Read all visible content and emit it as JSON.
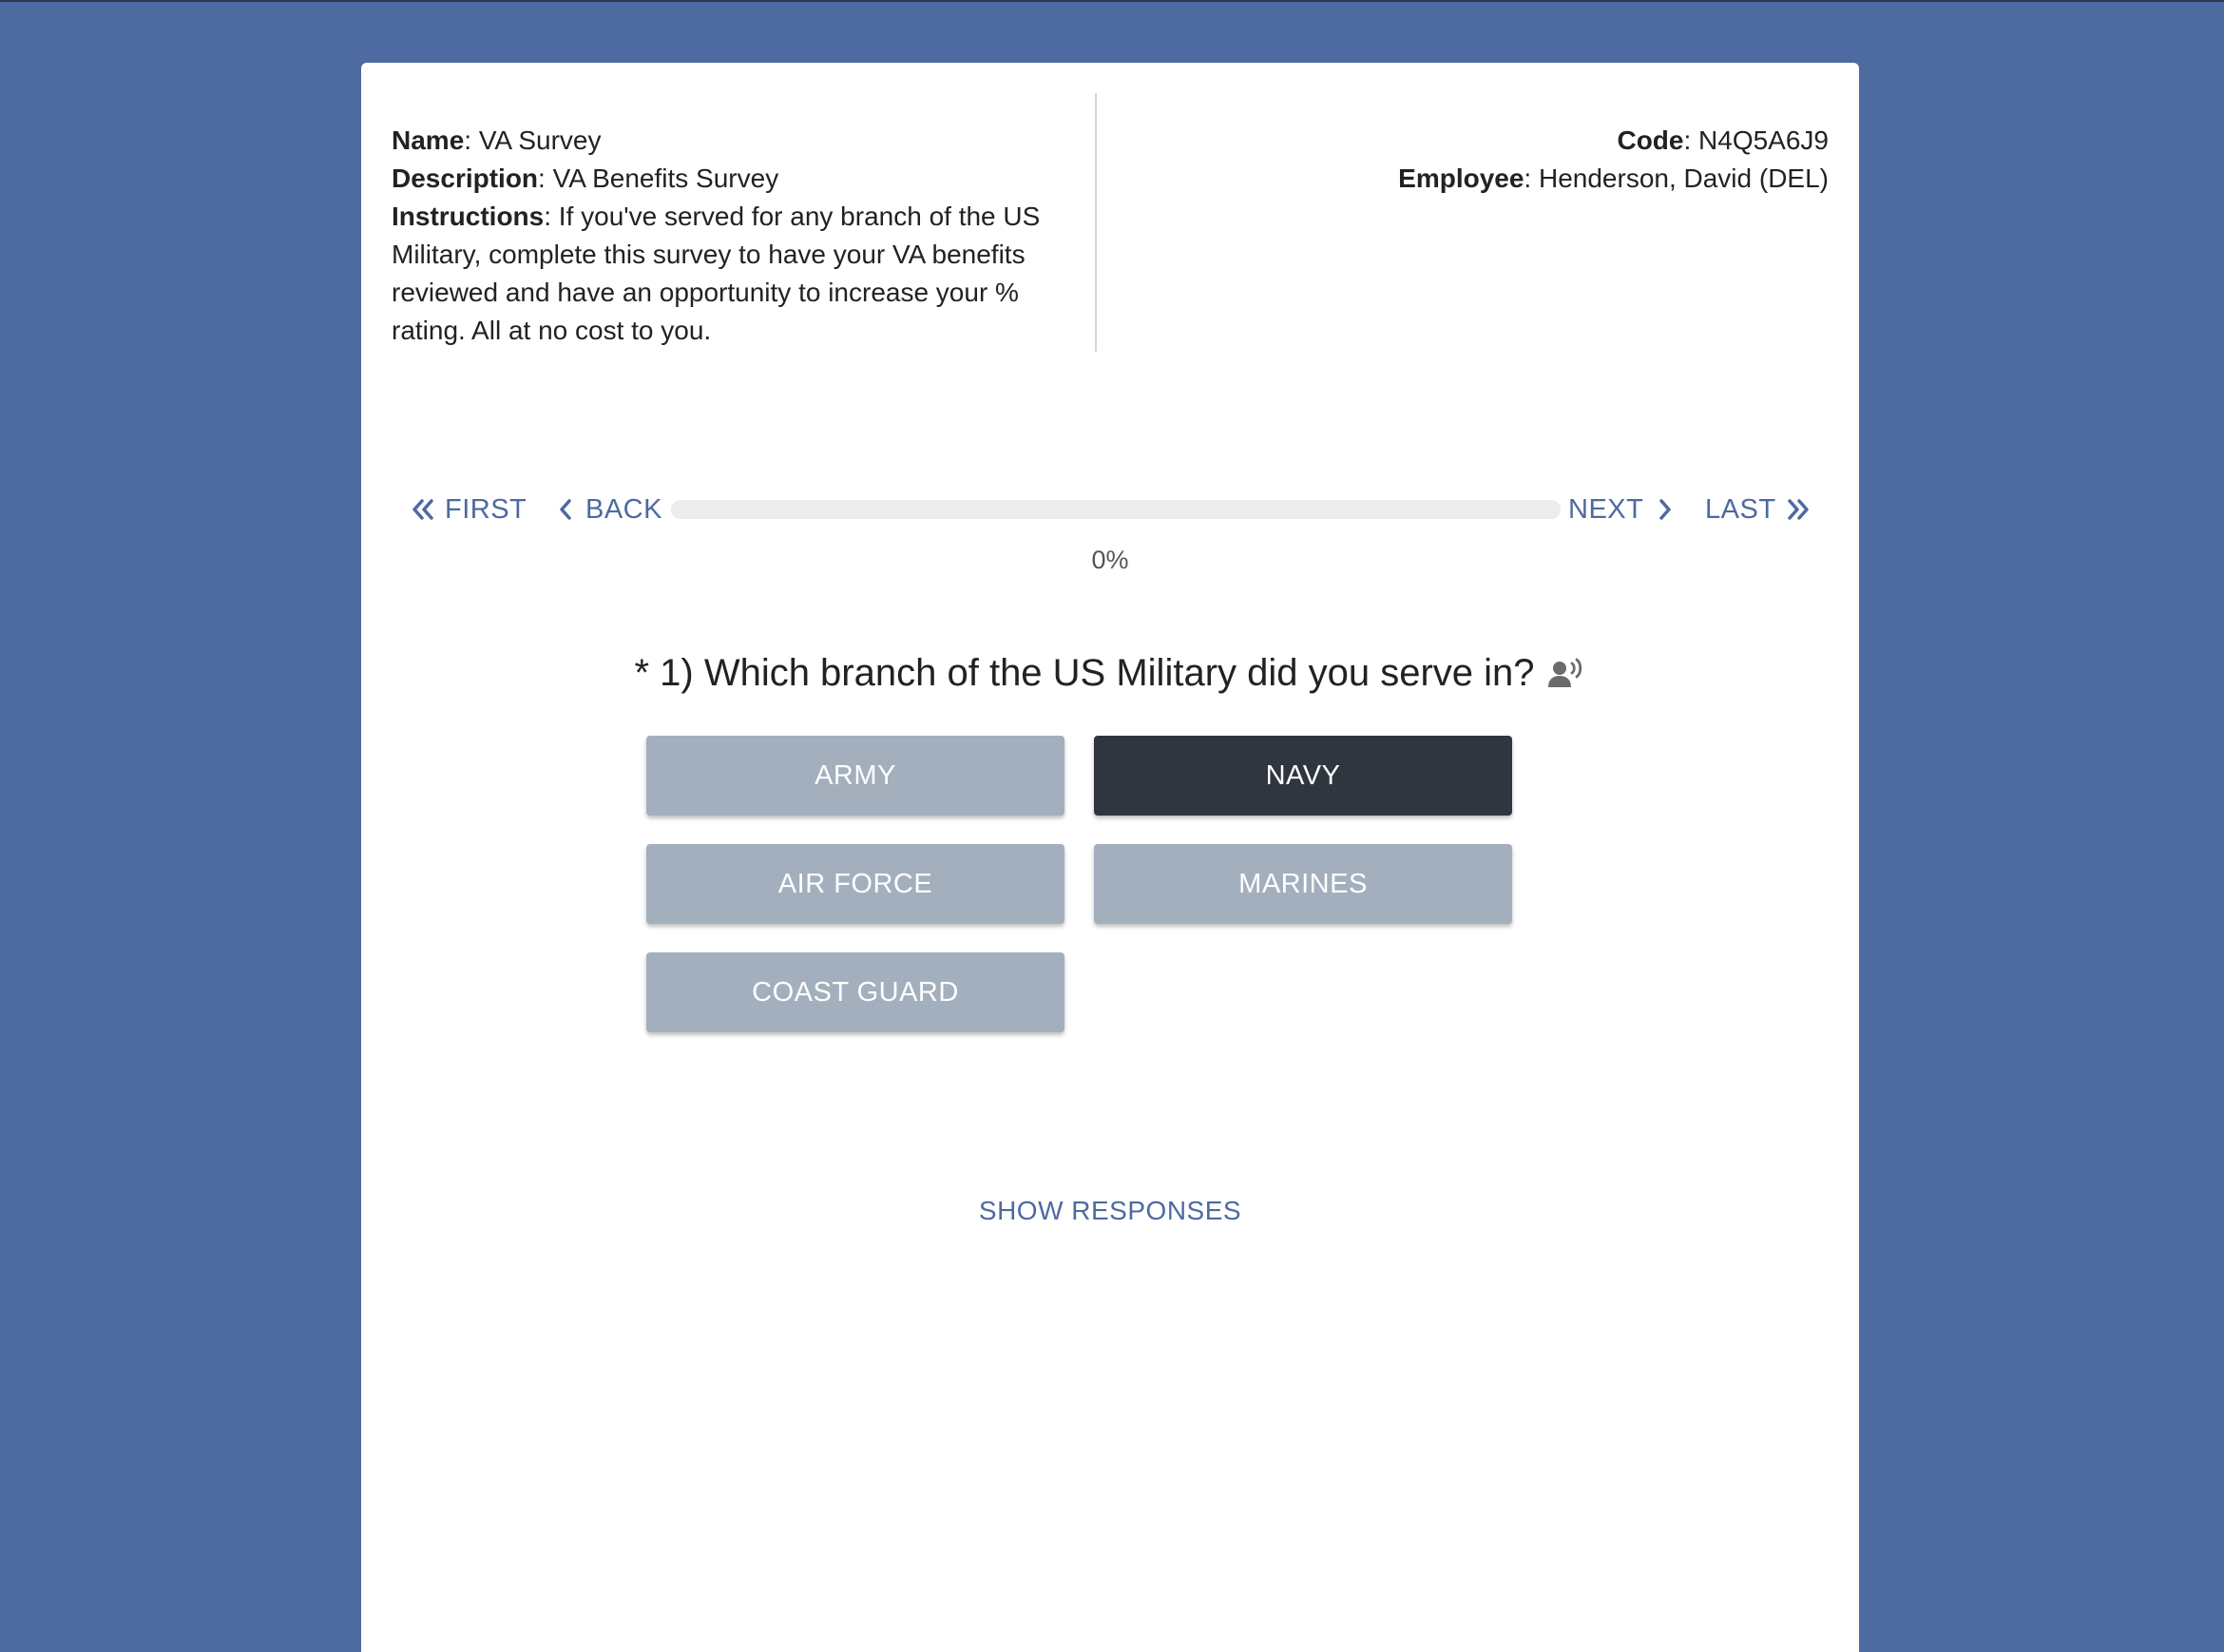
{
  "survey": {
    "name_label": "Name",
    "name_value": ": VA Survey",
    "description_label": "Description",
    "description_value": ": VA Benefits Survey",
    "instructions_label": "Instructions",
    "instructions_value": ": If you've served for any branch of the US Military, complete this survey to have your VA benefits reviewed and have an opportunity to increase your % rating. All at no cost to you.",
    "code_label": "Code",
    "code_value": ": N4Q5A6J9",
    "employee_label": "Employee",
    "employee_value": ": Henderson, David (DEL)"
  },
  "navigation": {
    "first_label": "FIRST",
    "back_label": "BACK",
    "next_label": "NEXT",
    "last_label": "LAST",
    "progress_percent": 0,
    "progress_text": "0%"
  },
  "question": {
    "text": "* 1) Which branch of the US Military did you serve in?",
    "options": [
      {
        "label": "ARMY",
        "selected": false
      },
      {
        "label": "NAVY",
        "selected": true
      },
      {
        "label": "AIR FORCE",
        "selected": false
      },
      {
        "label": "MARINES",
        "selected": false
      },
      {
        "label": "COAST GUARD",
        "selected": false
      }
    ]
  },
  "footer": {
    "show_responses_label": "SHOW RESPONSES"
  },
  "colors": {
    "background": "#4d6aa1",
    "accent": "#4d6aa1",
    "option_default": "#a3afbd",
    "option_selected": "#2f3640"
  },
  "icons": {
    "first": "double-chevron-left-icon",
    "back": "chevron-left-icon",
    "next": "chevron-right-icon",
    "last": "double-chevron-right-icon",
    "speak": "speaker-person-icon"
  }
}
